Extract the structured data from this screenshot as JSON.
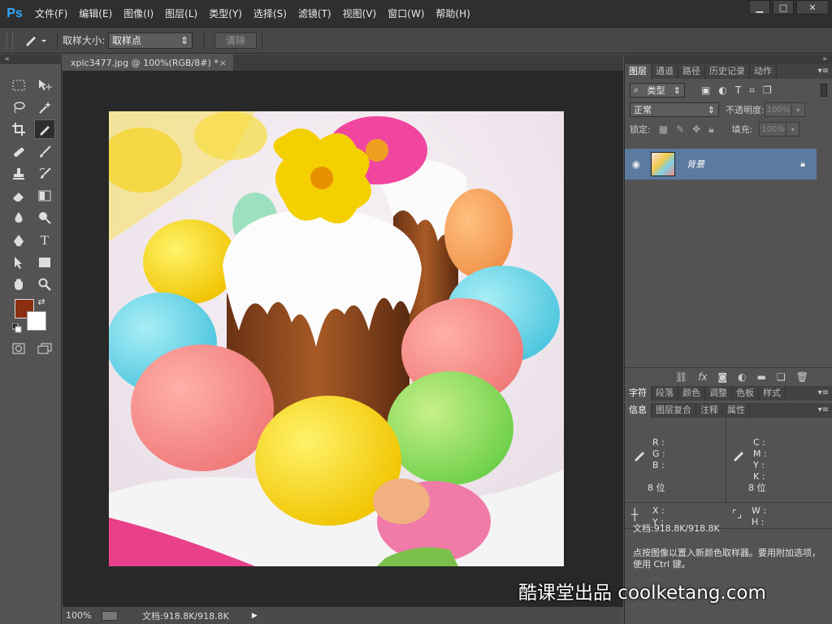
{
  "app": {
    "logo": "Ps"
  },
  "menu": [
    "文件(F)",
    "编辑(E)",
    "图像(I)",
    "图层(L)",
    "类型(Y)",
    "选择(S)",
    "滤镜(T)",
    "视图(V)",
    "窗口(W)",
    "帮助(H)"
  ],
  "window": {
    "min": "▁",
    "max": "□",
    "close": "✕"
  },
  "options": {
    "sample_size_label": "取样大小:",
    "sample_size_value": "取样点",
    "clear_button": "清除"
  },
  "document": {
    "tab_title": "xpic3477.jpg @ 100%(RGB/8#) *",
    "tab_close": "×",
    "zoom": "100%",
    "doc_size": "文档:918.8K/918.8K"
  },
  "colors": {
    "foreground": "#8a2f0f",
    "background": "#ffffff",
    "accent": "#5b7aa0"
  },
  "layers_panel": {
    "tabs": [
      "图层",
      "通道",
      "路径",
      "历史记录",
      "动作"
    ],
    "filter_kind": "类型",
    "blend_mode": "正常",
    "opacity_label": "不透明度:",
    "opacity_value": "100%",
    "lock_label": "锁定:",
    "fill_label": "填充:",
    "fill_value": "100%",
    "layer_name": "背景"
  },
  "char_panel": {
    "tabs": [
      "字符",
      "段落",
      "颜色",
      "调整",
      "色板",
      "样式"
    ]
  },
  "info_panel": {
    "tabs": [
      "信息",
      "图层复合",
      "注释",
      "属性"
    ],
    "r": "R :",
    "g": "G :",
    "b": "B :",
    "c": "C :",
    "m": "M :",
    "y": "Y :",
    "k": "K :",
    "bits_left": "8 位",
    "bits_right": "8 位",
    "x": "X :",
    "y_coord": "Y :",
    "w": "W :",
    "h": "H :",
    "doc": "文档:918.8K/918.8K",
    "hint": "点按图像以置入新颜色取样器。要用附加选项，使用 Ctrl 键。"
  },
  "watermark": "酷课堂出品 coolketang.com"
}
